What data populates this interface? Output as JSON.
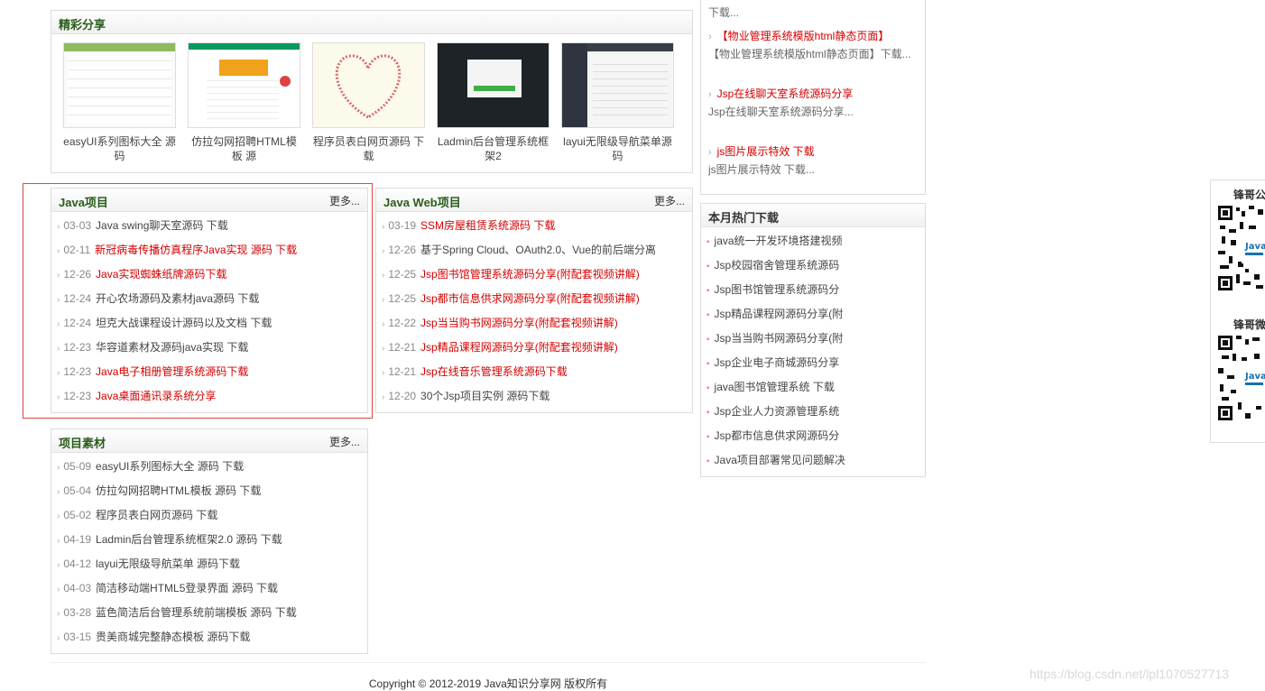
{
  "share": {
    "title": "精彩分享",
    "items": [
      {
        "caption": "easyUI系列图标大全 源码"
      },
      {
        "caption": "仿拉勾网招聘HTML模板 源"
      },
      {
        "caption": "程序员表白网页源码 下载"
      },
      {
        "caption": "Ladmin后台管理系统框架2"
      },
      {
        "caption": "layui无限级导航菜单源码"
      }
    ]
  },
  "java": {
    "title": "Java项目",
    "more": "更多...",
    "items": [
      {
        "date": "03-03",
        "text": "Java swing聊天室源码 下载",
        "red": false
      },
      {
        "date": "02-11",
        "text": "新冠病毒传播仿真程序Java实现 源码 下载",
        "red": true
      },
      {
        "date": "12-26",
        "text": "Java实现蜘蛛纸牌源码下载",
        "red": true
      },
      {
        "date": "12-24",
        "text": "开心农场源码及素材java源码 下载",
        "red": false
      },
      {
        "date": "12-24",
        "text": "坦克大战课程设计源码以及文档 下载",
        "red": false
      },
      {
        "date": "12-23",
        "text": "华容道素材及源码java实现 下载",
        "red": false
      },
      {
        "date": "12-23",
        "text": "Java电子相册管理系统源码下载",
        "red": true
      },
      {
        "date": "12-23",
        "text": "Java桌面通讯录系统分享",
        "red": true
      }
    ]
  },
  "javaweb": {
    "title": "Java Web项目",
    "more": "更多...",
    "items": [
      {
        "date": "03-19",
        "text": "SSM房屋租赁系统源码 下载",
        "red": true
      },
      {
        "date": "12-26",
        "text": "基于Spring Cloud、OAuth2.0、Vue的前后端分离",
        "red": false
      },
      {
        "date": "12-25",
        "text": "Jsp图书馆管理系统源码分享(附配套视频讲解)",
        "red": true
      },
      {
        "date": "12-25",
        "text": "Jsp都市信息供求网源码分享(附配套视频讲解)",
        "red": true
      },
      {
        "date": "12-22",
        "text": "Jsp当当购书网源码分享(附配套视频讲解)",
        "red": true
      },
      {
        "date": "12-21",
        "text": "Jsp精品课程网源码分享(附配套视频讲解)",
        "red": true
      },
      {
        "date": "12-21",
        "text": "Jsp在线音乐管理系统源码下载",
        "red": true
      },
      {
        "date": "12-20",
        "text": "30个Jsp项目实例 源码下载",
        "red": false
      }
    ]
  },
  "material": {
    "title": "项目素材",
    "more": "更多...",
    "items": [
      {
        "date": "05-09",
        "text": "easyUI系列图标大全 源码 下载"
      },
      {
        "date": "05-04",
        "text": "仿拉勾网招聘HTML模板 源码 下载"
      },
      {
        "date": "05-02",
        "text": "程序员表白网页源码 下载"
      },
      {
        "date": "04-19",
        "text": "Ladmin后台管理系统框架2.0 源码 下载"
      },
      {
        "date": "04-12",
        "text": "layui无限级导航菜单 源码下载"
      },
      {
        "date": "04-03",
        "text": "简洁移动端HTML5登录界面 源码 下载"
      },
      {
        "date": "03-28",
        "text": "蓝色简洁后台管理系统前端模板 源码 下载"
      },
      {
        "date": "03-15",
        "text": "贵美商城完整静态模板 源码下载"
      }
    ]
  },
  "recommend": {
    "top_text": "下载...",
    "items": [
      {
        "title": "【物业管理系统模版html静态页面】",
        "desc": "【物业管理系统模版html静态页面】下载..."
      },
      {
        "title": "Jsp在线聊天室系统源码分享",
        "desc": "Jsp在线聊天室系统源码分享..."
      },
      {
        "title": "js图片展示特效 下载",
        "desc": "js图片展示特效 下载..."
      }
    ]
  },
  "hot": {
    "title": "本月热门下载",
    "items": [
      {
        "text": "java统一开发环境搭建视频",
        "gray": false
      },
      {
        "text": "Jsp校园宿舍管理系统源码",
        "gray": false
      },
      {
        "text": "Jsp图书馆管理系统源码分",
        "gray": false
      },
      {
        "text": "Jsp精品课程网源码分享(附",
        "gray": false
      },
      {
        "text": "Jsp当当购书网源码分享(附",
        "gray": false
      },
      {
        "text": "Jsp企业电子商城源码分享",
        "gray": false
      },
      {
        "text": "java图书馆管理系统 下载",
        "gray": false
      },
      {
        "text": "Jsp企业人力资源管理系统",
        "gray": false
      },
      {
        "text": "Jsp都市信息供求网源码分",
        "gray": false
      },
      {
        "text": "Java项目部署常见问题解决",
        "gray": true
      }
    ]
  },
  "float": {
    "label1": "锋哥公",
    "label2": "锋哥微"
  },
  "footer": {
    "copyright": "Copyright © 2012-2019 Java知识分享网 版权所有"
  },
  "watermark": "https://blog.csdn.net/lpl1070527713"
}
